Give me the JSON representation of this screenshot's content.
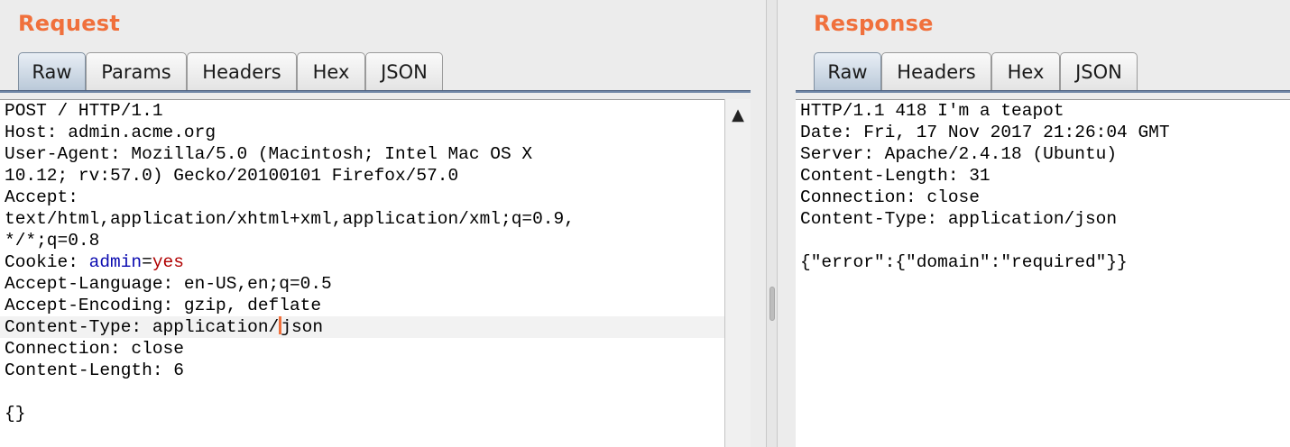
{
  "request": {
    "title": "Request",
    "tabs": [
      "Raw",
      "Params",
      "Headers",
      "Hex",
      "JSON"
    ],
    "active_tab": "Raw",
    "lines": [
      "POST / HTTP/1.1",
      "Host: admin.acme.org",
      "User-Agent: Mozilla/5.0 (Macintosh; Intel Mac OS X",
      "10.12; rv:57.0) Gecko/20100101 Firefox/57.0",
      "Accept:",
      "text/html,application/xhtml+xml,application/xml;q=0.9,",
      "*/*;q=0.8",
      "Accept-Language: en-US,en;q=0.5",
      "Accept-Encoding: gzip, deflate",
      "Connection: close",
      "Content-Length: 6",
      "",
      "{}"
    ],
    "cookie": {
      "label": "Cookie: ",
      "name": "admin",
      "equals": "=",
      "value": "yes"
    },
    "content_type_line": {
      "before_caret": "Content-Type: application/",
      "after_caret": "json"
    },
    "scroll_up_icon": "▲"
  },
  "response": {
    "title": "Response",
    "tabs": [
      "Raw",
      "Headers",
      "Hex",
      "JSON"
    ],
    "active_tab": "Raw",
    "lines": [
      "HTTP/1.1 418 I'm a teapot",
      "Date: Fri, 17 Nov 2017 21:26:04 GMT",
      "Server: Apache/2.4.18 (Ubuntu)",
      "Content-Length: 31",
      "Connection: close",
      "Content-Type: application/json",
      "",
      "{\"error\":{\"domain\":\"required\"}}"
    ]
  },
  "colors": {
    "title": "#f0703c",
    "caret": "#f0703c",
    "cookie_name": "#0b0bb0",
    "cookie_value": "#b00000"
  }
}
